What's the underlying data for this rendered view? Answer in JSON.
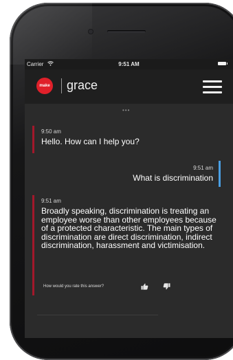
{
  "status_bar": {
    "carrier": "Carrier",
    "time": "9:51 AM"
  },
  "header": {
    "logo_text": "make",
    "brand": "grace",
    "menu_icon": "hamburger-menu-icon"
  },
  "drag_handle": "•••",
  "messages": [
    {
      "sender": "bot",
      "timestamp": "9:50 am",
      "text": "Hello. How can I help you?"
    },
    {
      "sender": "user",
      "timestamp": "9:51 am",
      "text": "What is discrimination"
    },
    {
      "sender": "bot",
      "timestamp": "9:51 am",
      "text": "Broadly speaking, discrimination is treating an employee worse than other employees because of a protected characteristic. The main types of discrimination are direct discrimination, indirect discrimination, harassment and victimisation.",
      "rating_prompt": "How would you rate this answer?"
    }
  ],
  "colors": {
    "brand_red": "#e0202a",
    "bot_accent": "#a3182b",
    "user_accent": "#4a9fe3",
    "screen_bg": "#2b2b2b",
    "header_bg": "#1f1f1f"
  }
}
